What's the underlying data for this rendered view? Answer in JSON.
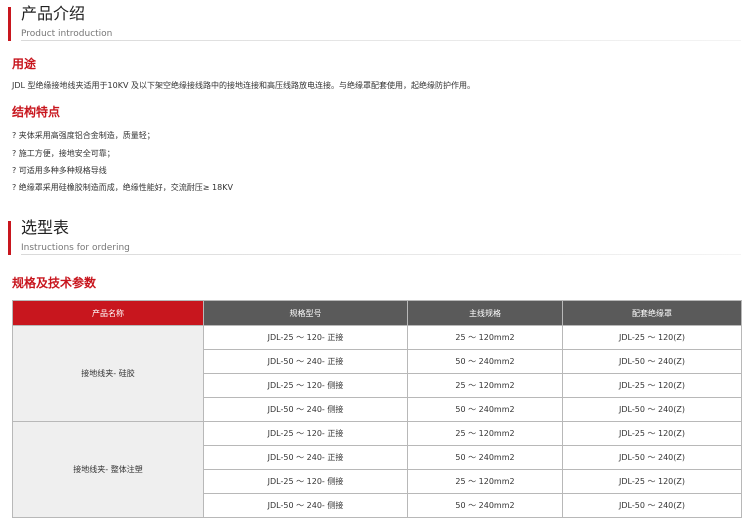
{
  "intro": {
    "title": "产品介绍",
    "subtitle": "Product introduction"
  },
  "usage": {
    "heading": "用途",
    "text": "JDL 型绝缘接地线夹适用于10KV 及以下架空绝缘接线路中的接地连接和高压线路放电连接。与绝缘罩配套使用，起绝缘防护作用。"
  },
  "features": {
    "heading": "结构特点",
    "items": [
      "? 夹体采用高强度铝合金制造，质量轻；",
      "? 施工方便，接地安全可靠；",
      "? 可适用多种多种规格导线",
      "? 绝缘罩采用硅橡胶制造而成，绝缘性能好，交流耐压≥ 18KV"
    ]
  },
  "ordering": {
    "title": "选型表",
    "subtitle": "Instructions for ordering"
  },
  "spec": {
    "heading": "规格及技术参数",
    "columns": [
      "产品名称",
      "规格型号",
      "主线规格",
      "配套绝缘罩"
    ],
    "groups": [
      {
        "name": "接地线夹- 硅胶",
        "rows": [
          [
            "JDL-25 ～ 120- 正接",
            "25 ～ 120mm2",
            "JDL-25 ～ 120(Z)"
          ],
          [
            "JDL-50 ～ 240- 正接",
            "50 ～ 240mm2",
            "JDL-50 ～ 240(Z)"
          ],
          [
            "JDL-25 ～ 120- 侧接",
            "25 ～ 120mm2",
            "JDL-25 ～ 120(Z)"
          ],
          [
            "JDL-50 ～ 240- 侧接",
            "50 ～ 240mm2",
            "JDL-50 ～ 240(Z)"
          ]
        ]
      },
      {
        "name": "接地线夹- 整体注塑",
        "rows": [
          [
            "JDL-25 ～ 120- 正接",
            "25 ～ 120mm2",
            "JDL-25 ～ 120(Z)"
          ],
          [
            "JDL-50 ～ 240- 正接",
            "50 ～ 240mm2",
            "JDL-50 ～ 240(Z)"
          ],
          [
            "JDL-25 ～ 120- 侧接",
            "25 ～ 120mm2",
            "JDL-25 ～ 120(Z)"
          ],
          [
            "JDL-50 ～ 240- 侧接",
            "50 ～ 240mm2",
            "JDL-50 ～ 240(Z)"
          ]
        ]
      }
    ]
  },
  "colors": {
    "accent": "#c8161e",
    "header_dark": "#5a5a5a",
    "group_bg": "#efefef"
  }
}
